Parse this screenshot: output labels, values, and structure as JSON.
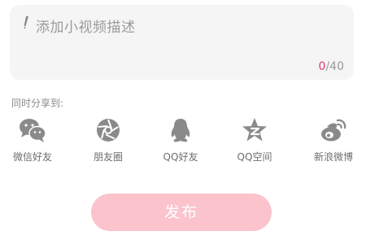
{
  "description": {
    "placeholder": "添加小视频描述",
    "icon": "pencil-icon",
    "counter_current": "0",
    "counter_separator": "/",
    "counter_max": "40"
  },
  "share": {
    "title": "同时分享到:",
    "items": [
      {
        "label": "微信好友",
        "icon": "wechat-icon"
      },
      {
        "label": "朋友圈",
        "icon": "moments-icon"
      },
      {
        "label": "QQ好友",
        "icon": "qq-icon"
      },
      {
        "label": "QQ空间",
        "icon": "qzone-icon"
      },
      {
        "label": "新浪微博",
        "icon": "weibo-icon"
      }
    ]
  },
  "publish": {
    "label": "发布"
  },
  "colors": {
    "accent": "#e8337a",
    "button": "#fbc3cc",
    "icon": "#8a8a8a"
  }
}
